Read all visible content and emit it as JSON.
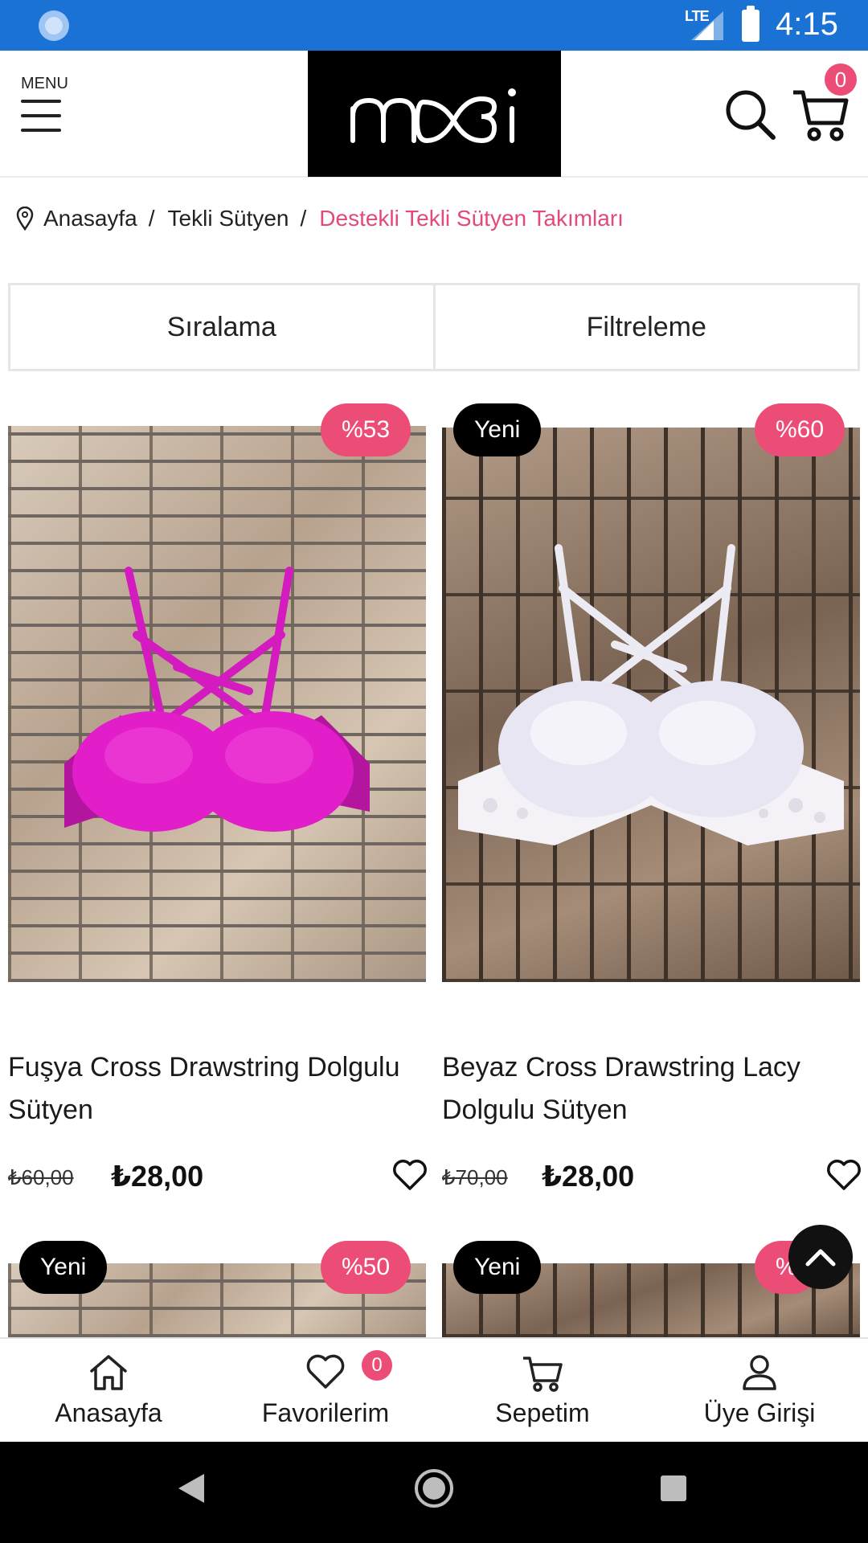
{
  "status_bar": {
    "network": "LTE",
    "time": "4:15"
  },
  "header": {
    "menu_label": "MENU",
    "logo_text": "mxi",
    "cart_count": "0"
  },
  "breadcrumb": {
    "items": [
      "Anasayfa",
      "Tekli Sütyen",
      "Destekli Tekli Sütyen Takımları"
    ],
    "separator": "/"
  },
  "toolbar": {
    "sort_label": "Sıralama",
    "filter_label": "Filtreleme"
  },
  "products": [
    {
      "name": "Fuşya Cross Drawstring Dolgulu Sütyen",
      "old_price": "₺60,00",
      "price": "₺28,00",
      "discount_badge": "%53",
      "new_badge": "",
      "color": "#d41bbf"
    },
    {
      "name": "Beyaz Cross Drawstring Lacy Dolgulu Sütyen",
      "old_price": "₺70,00",
      "price": "₺28,00",
      "discount_badge": "%60",
      "new_badge": "Yeni",
      "color": "#eceaf5"
    },
    {
      "discount_badge": "%50",
      "new_badge": "Yeni"
    },
    {
      "discount_badge": "%",
      "new_badge": "Yeni"
    }
  ],
  "bottom_nav": {
    "home": "Anasayfa",
    "favorites": "Favorilerim",
    "favorites_count": "0",
    "cart": "Sepetim",
    "login": "Üye Girişi"
  },
  "colors": {
    "accent": "#ec4d77",
    "status_bar": "#1a73d4",
    "breadcrumb_active": "#e24a77"
  }
}
